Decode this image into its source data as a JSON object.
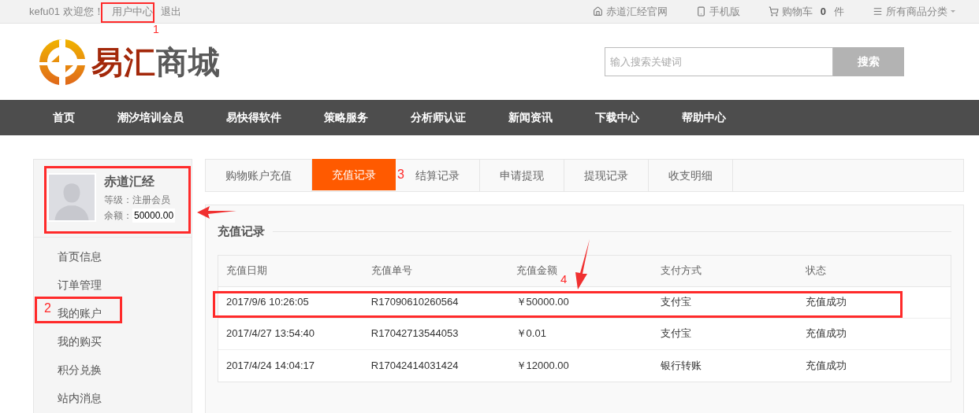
{
  "topbar": {
    "username": "kefu01",
    "greeting": "欢迎您！",
    "user_center": "用户中心",
    "logout": "退出",
    "links": [
      {
        "kind": "home",
        "label": "赤道汇经官网"
      },
      {
        "kind": "mobile",
        "label": "手机版"
      },
      {
        "kind": "cart",
        "label": "购物车",
        "count": "0",
        "unit": "件"
      },
      {
        "kind": "categories",
        "label": "所有商品分类"
      }
    ]
  },
  "logo": {
    "text_primary": "易汇",
    "text_secondary": "商城"
  },
  "search": {
    "placeholder": "输入搜索关键词",
    "button": "搜索"
  },
  "nav": [
    "首页",
    "潮汐培训会员",
    "易快得软件",
    "策略服务",
    "分析师认证",
    "新闻资讯",
    "下载中心",
    "帮助中心"
  ],
  "profile": {
    "name": "赤道汇经",
    "level_label": "等级：",
    "level": "注册会员",
    "balance_label": "余额：",
    "balance": "50000.00"
  },
  "sidebar": {
    "items": [
      "首页信息",
      "订单管理",
      "我的账户",
      "我的购买",
      "积分兑换",
      "站内消息"
    ]
  },
  "tabs": [
    {
      "label": "购物账户充值",
      "selected": false
    },
    {
      "label": "充值记录",
      "selected": true
    },
    {
      "label": "结算记录",
      "selected": false
    },
    {
      "label": "申请提现",
      "selected": false
    },
    {
      "label": "提现记录",
      "selected": false
    },
    {
      "label": "收支明细",
      "selected": false
    }
  ],
  "panel": {
    "title": "充值记录",
    "table": {
      "columns": [
        "充值日期",
        "充值单号",
        "充值金额",
        "支付方式",
        "状态"
      ],
      "rows": [
        [
          "2017/9/6 10:26:05",
          "R17090610260564",
          "￥50000.00",
          "支付宝",
          "充值成功"
        ],
        [
          "2017/4/27 13:54:40",
          "R17042713544053",
          "￥0.01",
          "支付宝",
          "充值成功"
        ],
        [
          "2017/4/24 14:04:17",
          "R17042414031424",
          "￥12000.00",
          "银行转账",
          "充值成功"
        ]
      ]
    }
  },
  "annotations": [
    {
      "label": "1"
    },
    {
      "label": "2"
    },
    {
      "label": "3"
    },
    {
      "label": "4"
    }
  ]
}
